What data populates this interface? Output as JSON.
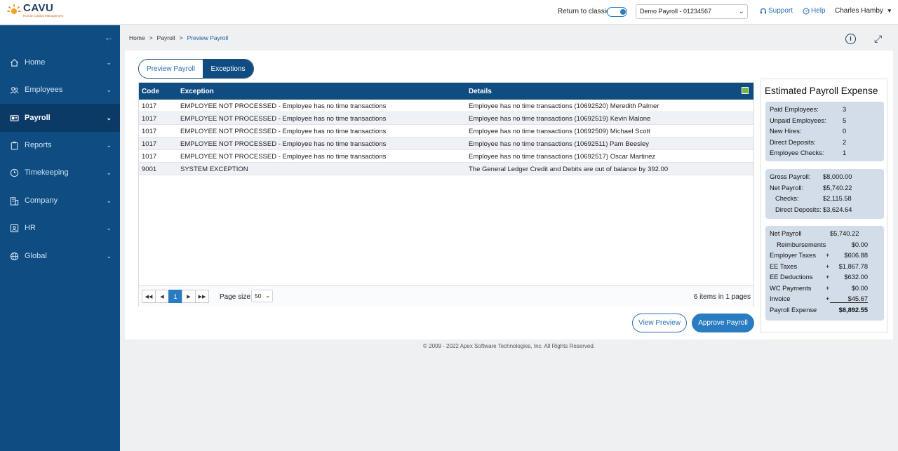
{
  "brand": {
    "name": "CAVU",
    "tagline": "Human Capital Management"
  },
  "topbar": {
    "return_label": "Return to classic",
    "company_select": "Demo Payroll - 01234567",
    "support": "Support",
    "help": "Help",
    "user": "Charles Hamby"
  },
  "sidebar": {
    "items": [
      {
        "label": "Home",
        "icon": "home-icon"
      },
      {
        "label": "Employees",
        "icon": "users-icon"
      },
      {
        "label": "Payroll",
        "icon": "payroll-icon",
        "active": true
      },
      {
        "label": "Reports",
        "icon": "clipboard-icon"
      },
      {
        "label": "Timekeeping",
        "icon": "clock-icon"
      },
      {
        "label": "Company",
        "icon": "building-icon"
      },
      {
        "label": "HR",
        "icon": "id-card-icon"
      },
      {
        "label": "Global",
        "icon": "globe-icon"
      }
    ]
  },
  "breadcrumb": {
    "home": "Home",
    "payroll": "Payroll",
    "current": "Preview Payroll",
    "sep": ">"
  },
  "tabs": {
    "preview": "Preview Payroll",
    "exceptions": "Exceptions"
  },
  "grid": {
    "headers": {
      "code": "Code",
      "exception": "Exception",
      "details": "Details"
    },
    "rows": [
      {
        "code": "1017",
        "exception": "EMPLOYEE NOT PROCESSED - Employee has no time transactions",
        "details": "Employee has no time transactions (10692520) Meredith Palmer"
      },
      {
        "code": "1017",
        "exception": "EMPLOYEE NOT PROCESSED - Employee has no time transactions",
        "details": "Employee has no time transactions (10692519) Kevin Malone"
      },
      {
        "code": "1017",
        "exception": "EMPLOYEE NOT PROCESSED - Employee has no time transactions",
        "details": "Employee has no time transactions (10692509) Michael Scott"
      },
      {
        "code": "1017",
        "exception": "EMPLOYEE NOT PROCESSED - Employee has no time transactions",
        "details": "Employee has no time transactions (10692511) Pam Beesley"
      },
      {
        "code": "1017",
        "exception": "EMPLOYEE NOT PROCESSED - Employee has no time transactions",
        "details": "Employee has no time transactions (10692517) Oscar Martinez"
      },
      {
        "code": "9001",
        "exception": "SYSTEM EXCEPTION",
        "details": "The General Ledger Credit and Debits are out of balance by 392.00"
      }
    ],
    "pager": {
      "current_page": "1",
      "page_size_label": "Page size:",
      "page_size": "50",
      "info": "6 items in 1 pages"
    }
  },
  "buttons": {
    "view_preview": "View Preview",
    "approve_payroll": "Approve Payroll"
  },
  "expense": {
    "title": "Estimated Payroll Expense",
    "counts": [
      {
        "label": "Paid Employees:",
        "value": "3"
      },
      {
        "label": "Unpaid Employees:",
        "value": "5"
      },
      {
        "label": "New Hires:",
        "value": "0"
      },
      {
        "label": "Direct Deposits:",
        "value": "2"
      },
      {
        "label": "Employee Checks:",
        "value": "1"
      }
    ],
    "payroll": [
      {
        "label": "Gross Payroll:",
        "value": "$8,000.00"
      },
      {
        "label": "Net Payroll:",
        "value": "$5,740.22"
      },
      {
        "label": "Checks:",
        "value": "$2,115.58"
      },
      {
        "label": "Direct Deposits:",
        "value": "$3,624.64"
      }
    ],
    "summary": [
      {
        "label": "Net Payroll",
        "op": "",
        "value": "$5,740.22"
      },
      {
        "label": "Reimbursements",
        "op": "",
        "value": "$0.00"
      },
      {
        "label": "Employer Taxes",
        "op": "+",
        "value": "$606.88"
      },
      {
        "label": "EE Taxes",
        "op": "+",
        "value": "$1,867.78"
      },
      {
        "label": "EE Deductions",
        "op": "+",
        "value": "$632.00"
      },
      {
        "label": "WC Payments",
        "op": "+",
        "value": "$0.00"
      },
      {
        "label": "Invoice",
        "op": "+",
        "value": "$45.67"
      },
      {
        "label": "Payroll Expense",
        "op": "",
        "value": "$8,892.55"
      }
    ]
  },
  "footer": "© 2009 - 2022 Apex Software Technologies, Inc. All Rights Reserved.",
  "colors": {
    "sidebar": "#0f4c81",
    "sidebar_active": "#0b3a66",
    "accent": "#2a7cc2",
    "grid_header": "#0f4c81",
    "summary_box": "#d2dde9"
  }
}
